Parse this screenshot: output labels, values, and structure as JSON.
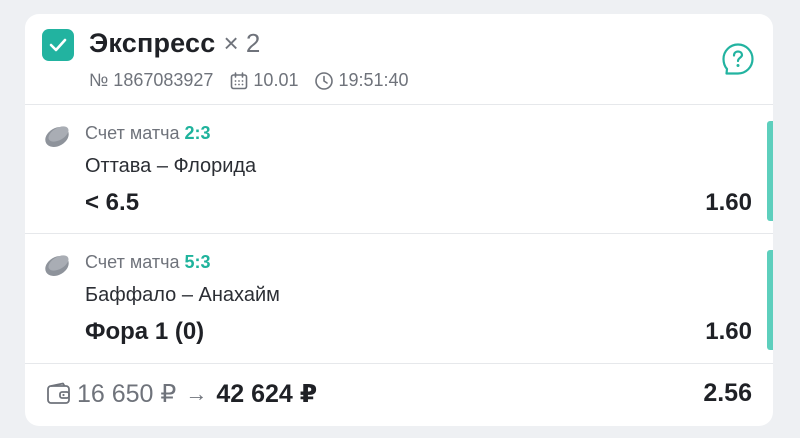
{
  "header": {
    "title": "Экспресс",
    "multiplier": "× 2",
    "ticket_number": "№ 1867083927",
    "date": "10.01",
    "time": "19:51:40",
    "checked": true
  },
  "bets": [
    {
      "market_label": "Счет матча",
      "score": "2:3",
      "teams": "Оттава – Флорида",
      "outcome": "< 6.5",
      "coefficient": "1.60"
    },
    {
      "market_label": "Счет матча",
      "score": "5:3",
      "teams": "Баффало – Анахайм",
      "outcome": "Фора 1 (0)",
      "coefficient": "1.60"
    }
  ],
  "footer": {
    "stake": "16 650 ₽",
    "arrow": "→",
    "potential_win": "42 624 ₽",
    "total_coefficient": "2.56"
  },
  "colors": {
    "accent": "#22b3a0",
    "score_green": "#1fb39c",
    "background": "#eef0f3",
    "card": "#ffffff"
  },
  "icons": [
    "check-icon",
    "calendar-icon",
    "clock-icon",
    "help-icon",
    "hockey-puck-icon",
    "wallet-icon"
  ]
}
